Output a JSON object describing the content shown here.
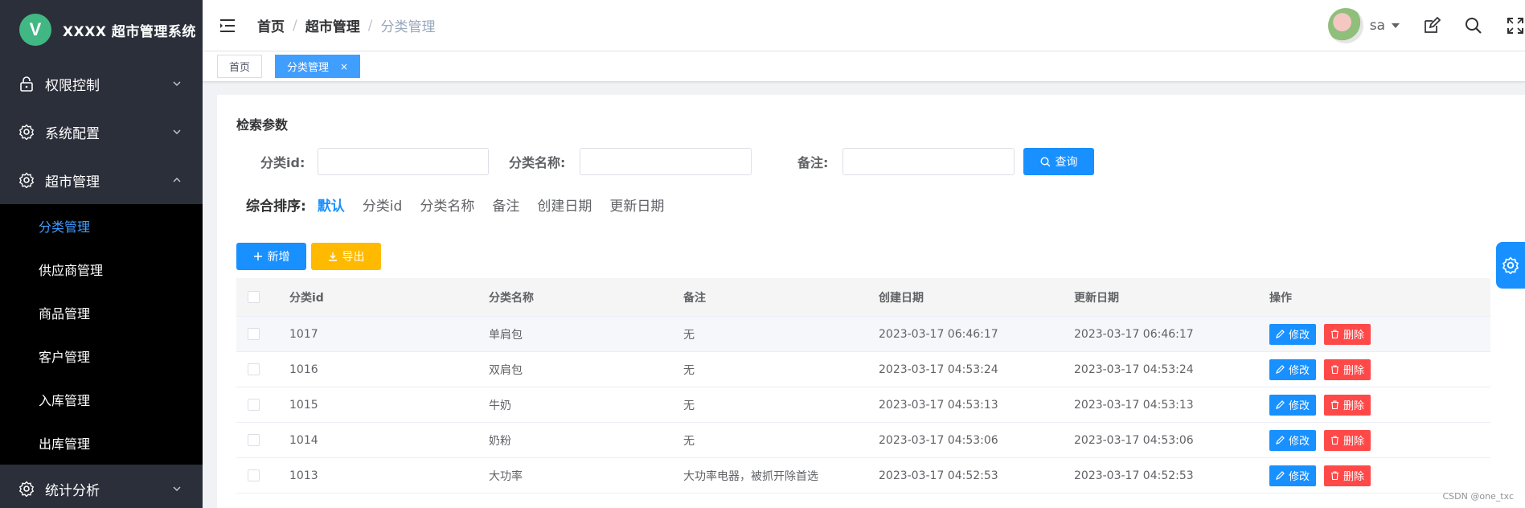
{
  "app": {
    "logo_letter": "V",
    "title": "XXXX 超市管理系统"
  },
  "sidebar": {
    "menus": [
      {
        "label": "权限控制",
        "icon": "lock-icon",
        "expanded": false
      },
      {
        "label": "系统配置",
        "icon": "gear-icon",
        "expanded": false
      },
      {
        "label": "超市管理",
        "icon": "gear-icon",
        "expanded": true
      },
      {
        "label": "统计分析",
        "icon": "gear-icon",
        "expanded": false
      }
    ],
    "submenu": [
      {
        "label": "分类管理",
        "active": true
      },
      {
        "label": "供应商管理"
      },
      {
        "label": "商品管理"
      },
      {
        "label": "客户管理"
      },
      {
        "label": "入库管理"
      },
      {
        "label": "出库管理"
      }
    ]
  },
  "header": {
    "breadcrumb": [
      "首页",
      "超市管理",
      "分类管理"
    ],
    "separator": "/",
    "username": "sa"
  },
  "tags": [
    {
      "label": "首页",
      "active": false
    },
    {
      "label": "分类管理",
      "active": true,
      "close": "×"
    }
  ],
  "search": {
    "title": "检索参数",
    "fields": [
      {
        "label": "分类id:",
        "value": ""
      },
      {
        "label": "分类名称:",
        "value": ""
      },
      {
        "label": "备注:",
        "value": ""
      }
    ],
    "query_button": "查询"
  },
  "sort": {
    "label": "综合排序:",
    "options": [
      "默认",
      "分类id",
      "分类名称",
      "备注",
      "创建日期",
      "更新日期"
    ],
    "active_index": 0
  },
  "actions": {
    "add": "新增",
    "export": "导出"
  },
  "table": {
    "columns": [
      "分类id",
      "分类名称",
      "备注",
      "创建日期",
      "更新日期",
      "操作"
    ],
    "rows": [
      {
        "id": "1017",
        "name": "单肩包",
        "remark": "无",
        "created": "2023-03-17 06:46:17",
        "updated": "2023-03-17 06:46:17"
      },
      {
        "id": "1016",
        "name": "双肩包",
        "remark": "无",
        "created": "2023-03-17 04:53:24",
        "updated": "2023-03-17 04:53:24"
      },
      {
        "id": "1015",
        "name": "牛奶",
        "remark": "无",
        "created": "2023-03-17 04:53:13",
        "updated": "2023-03-17 04:53:13"
      },
      {
        "id": "1014",
        "name": "奶粉",
        "remark": "无",
        "created": "2023-03-17 04:53:06",
        "updated": "2023-03-17 04:53:06"
      },
      {
        "id": "1013",
        "name": "大功率",
        "remark": "大功率电器，被抓开除首选",
        "created": "2023-03-17 04:52:53",
        "updated": "2023-03-17 04:52:53"
      }
    ],
    "edit_label": "修改",
    "delete_label": "删除"
  },
  "watermark": "CSDN @one_txc",
  "colors": {
    "primary": "#1890ff",
    "danger": "#ff4949",
    "warning": "#ffba00",
    "sidebar_bg": "#2b2f3a",
    "submenu_bg": "#000000"
  }
}
